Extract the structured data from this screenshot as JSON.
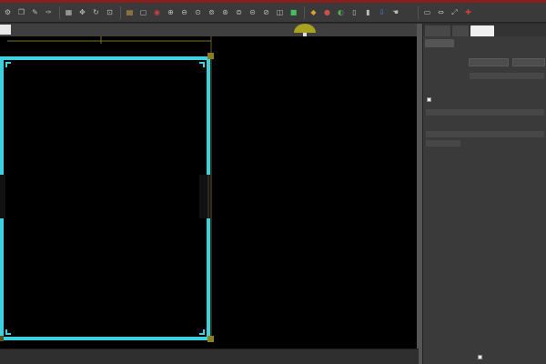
{
  "toolbar": {
    "left_icons": [
      "gear-icon",
      "copy-icon",
      "pen-icon",
      "pipette-icon",
      "grid-icon",
      "move-icon",
      "rotate-icon",
      "crop-icon",
      "layer-icon",
      "rect-icon"
    ],
    "mid_icons": [
      "record-icon",
      "zoom-in-icon",
      "zoom-out-icon",
      "zoom-fit-icon",
      "zoom-select-icon",
      "zoom-100-icon",
      "zoom-page-icon",
      "zoom-width-icon",
      "zoom-prev-icon",
      "view-icon",
      "color-grid-icon"
    ],
    "right_icons": [
      "palette-icon",
      "fill-icon",
      "stroke-icon",
      "doc-icon",
      "doc-alt-icon",
      "export-icon",
      "hand-icon"
    ],
    "far_right_icons": [
      "align-icon",
      "distribute-icon",
      "transform-icon",
      "snap-icon"
    ]
  },
  "panel": {
    "tabs": [
      "",
      "",
      ""
    ],
    "active_tab": 2,
    "section_header": "",
    "rows": [
      {
        "label": "",
        "btn1": "",
        "btn2": ""
      },
      {
        "label": ""
      },
      {
        "label": "",
        "check_label": ""
      },
      {
        "field": ""
      },
      {
        "label": ""
      },
      {
        "field": ""
      },
      {
        "field": ""
      }
    ],
    "footer_label": ""
  },
  "colors": {
    "accent": "#3fd0e0",
    "marker": "#a7a320",
    "titlebar": "#8a1f1f"
  }
}
